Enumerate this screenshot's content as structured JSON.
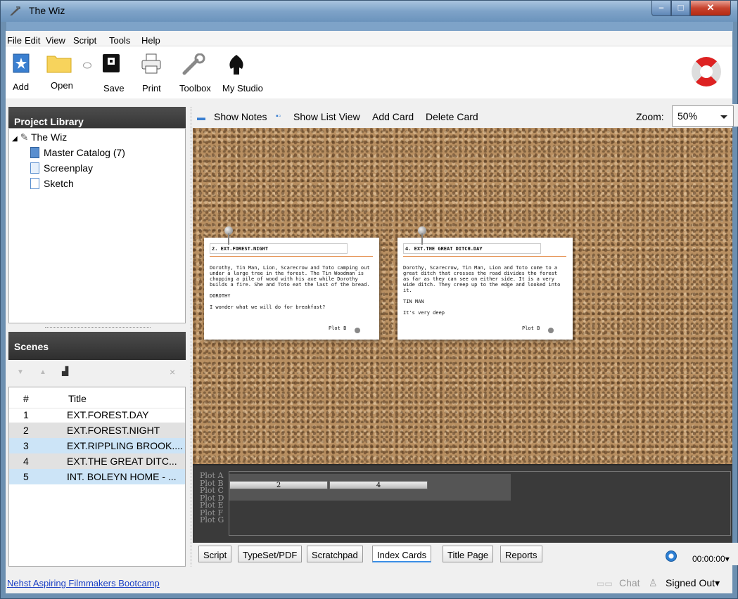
{
  "window": {
    "title": "The Wiz"
  },
  "menu": [
    "File",
    "Edit",
    "View",
    "Script",
    "Tools",
    "Help"
  ],
  "toolbar": {
    "add": "Add",
    "open": "Open",
    "save": "Save",
    "print": "Print",
    "toolbox": "Toolbox",
    "my_studio": "My Studio"
  },
  "library": {
    "title": "Project Library",
    "root": "The Wiz",
    "items": [
      "Master Catalog (7)",
      "Screenplay",
      "Sketch"
    ]
  },
  "scenes": {
    "title": "Scenes",
    "col_num": "#",
    "col_title": "Title",
    "rows": [
      {
        "num": "1",
        "title": "EXT.FOREST.DAY"
      },
      {
        "num": "2",
        "title": "EXT.FOREST.NIGHT"
      },
      {
        "num": "3",
        "title": "EXT.RIPPLING BROOK...."
      },
      {
        "num": "4",
        "title": "EXT.THE GREAT DITC..."
      },
      {
        "num": "5",
        "title": "INT. BOLEYN HOME - ..."
      }
    ]
  },
  "cards_toolbar": {
    "show_notes": "Show Notes",
    "show_list_view": "Show List View",
    "add_card": "Add Card",
    "delete_card": "Delete Card",
    "zoom_label": "Zoom:",
    "zoom_value": "50%"
  },
  "cards": [
    {
      "title": "2. EXT.FOREST.NIGHT",
      "body": "Dorothy, Tin Man, Lion, Scarecrow and Toto camping out under a large tree in the forest. The Tin Woodman is chopping a pile of wood with his axe while Dorothy builds a fire. She and Toto eat the last of the bread.\n\nDOROTHY\n\nI wonder what we will do for breakfast?",
      "plot": "Plot B"
    },
    {
      "title": "4. EXT.THE GREAT DITCH.DAY",
      "body": "Dorothy, Scarecrow, Tin Man, Lion and Toto come to a great ditch that crosses the road divides the forest as far as they can see on either side. It is a very wide ditch. They creep up to the edge and looked into it.\n\nTIN MAN\n\nIt's very deep",
      "plot": "Plot B"
    }
  ],
  "plots": {
    "labels": [
      "Plot A",
      "Plot B",
      "Plot C",
      "Plot D",
      "Plot E",
      "Plot F",
      "Plot G"
    ],
    "scene_bars": [
      "2",
      "4"
    ]
  },
  "tabs": [
    "Script",
    "TypeSet/PDF",
    "Scratchpad",
    "Index Cards",
    "Title Page",
    "Reports"
  ],
  "active_tab": "Index Cards",
  "timer": "00:00:00",
  "status": {
    "link": "Nehst Aspiring Filmmakers Bootcamp",
    "chat": "Chat",
    "signed_out": "Signed Out"
  }
}
